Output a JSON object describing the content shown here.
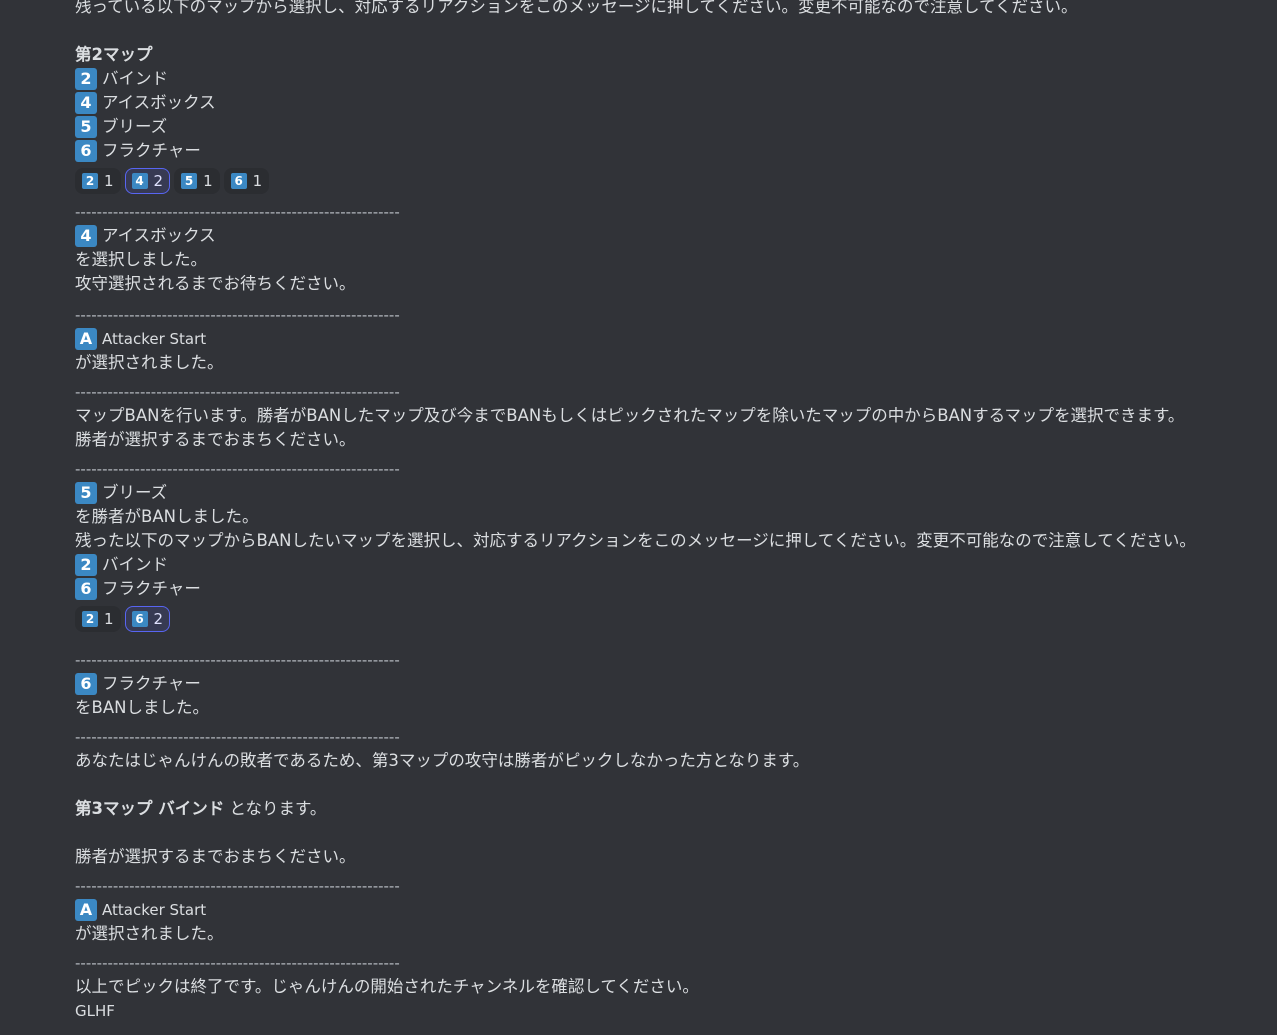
{
  "message": {
    "intro": "残っている以下のマップから選択し、対応するリアクションをこのメッセージに押してください。変更不可能なので注意してください。",
    "map2_heading": "第2マップ",
    "map2_options": [
      {
        "key": "2",
        "name": "バインド"
      },
      {
        "key": "4",
        "name": "アイスボックス"
      },
      {
        "key": "5",
        "name": "ブリーズ"
      },
      {
        "key": "6",
        "name": "フラクチャー"
      }
    ],
    "reactions1": [
      {
        "key": "2",
        "count": "1",
        "active": false
      },
      {
        "key": "4",
        "count": "2",
        "active": true
      },
      {
        "key": "5",
        "count": "1",
        "active": false
      },
      {
        "key": "6",
        "count": "1",
        "active": false
      }
    ],
    "separator": "------------------------------------------------------------",
    "selected_key": "4",
    "selected_name": "アイスボックス",
    "selected_done": "を選択しました。",
    "wait_side": "攻守選択されるまでお待ちください。",
    "side1_key": "A",
    "side1_name": "Attacker Start",
    "side1_done": "が選択されました。",
    "ban_intro": "マップBANを行います。勝者がBANしたマップ及び今までBANもしくはピックされたマップを除いたマップの中からBANするマップを選択できます。",
    "ban_wait": "勝者が選択するまでおまちください。",
    "winner_ban_key": "5",
    "winner_ban_name": "ブリーズ",
    "winner_ban_done": "を勝者がBANしました。",
    "ban_prompt": "残った以下のマップからBANしたいマップを選択し、対応するリアクションをこのメッセージに押してください。変更不可能なので注意してください。",
    "ban_options": [
      {
        "key": "2",
        "name": "バインド"
      },
      {
        "key": "6",
        "name": "フラクチャー"
      }
    ],
    "reactions2": [
      {
        "key": "2",
        "count": "1",
        "active": false
      },
      {
        "key": "6",
        "count": "2",
        "active": true
      }
    ],
    "banned_key": "6",
    "banned_name": "フラクチャー",
    "banned_done": "をBANしました。",
    "loser_note": "あなたはじゃんけんの敗者であるため、第3マップの攻守は勝者がピックしなかった方となります。",
    "map3_bold": "第3マップ バインド",
    "map3_rest": " となります。",
    "winner_wait": "勝者が選択するまでおまちください。",
    "side2_key": "A",
    "side2_name": "Attacker Start",
    "side2_done": "が選択されました。",
    "end_note": "以上でピックは終了です。じゃんけんの開始されたチャンネルを確認してください。",
    "glhf": "GLHF"
  }
}
